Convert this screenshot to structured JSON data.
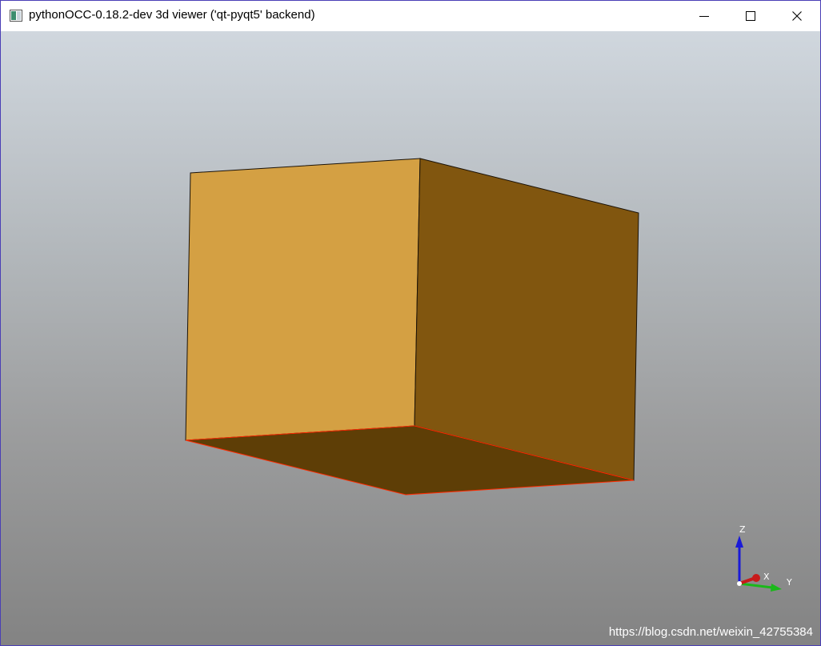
{
  "window": {
    "title": "pythonOCC-0.18.2-dev 3d viewer ('qt-pyqt5' backend)"
  },
  "icons": {
    "app": "app-window-icon",
    "minimize": "minimize-icon",
    "maximize": "maximize-icon",
    "close": "close-icon"
  },
  "viewport": {
    "object": "box",
    "colors": {
      "background_top": "#d0d7de",
      "background_bottom": "#838383",
      "front_face": "#d4a043",
      "side_face": "#81560f",
      "bottom_face": "#5e3e06",
      "highlight_edge": "#ff2a00"
    }
  },
  "triedron": {
    "z_label": "Z",
    "x_label": "X",
    "y_label": "Y",
    "colors": {
      "z": "#1a1ad8",
      "x": "#c81a1a",
      "y": "#1ab81a"
    }
  },
  "watermark": {
    "text": "https://blog.csdn.net/weixin_42755384"
  }
}
